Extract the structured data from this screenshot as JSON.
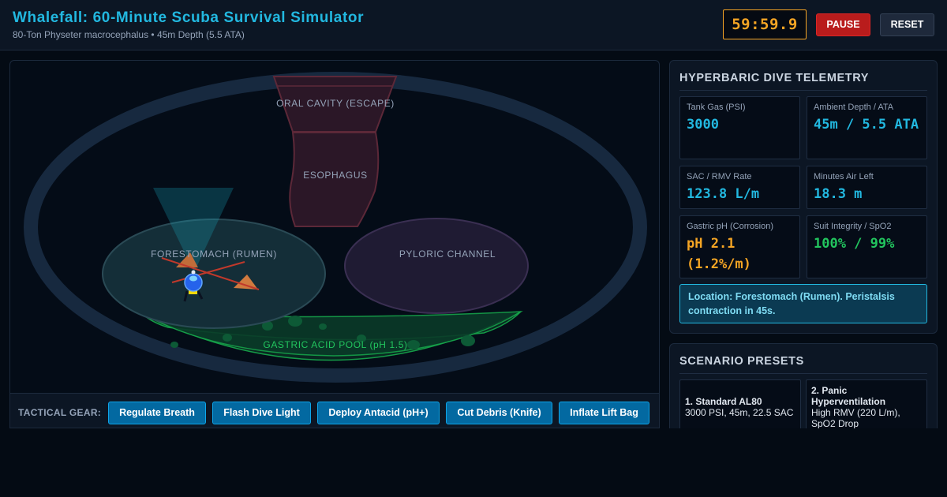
{
  "header": {
    "title": "Whalefall: 60-Minute Scuba Survival Simulator",
    "subtitle": "80-Ton Physeter macrocephalus • 45m Depth (5.5 ATA)",
    "timer": "59:59.9",
    "pause_label": "PAUSE",
    "reset_label": "RESET"
  },
  "map": {
    "regions": {
      "oral": "ORAL CAVITY (ESCAPE)",
      "esophagus": "ESOPHAGUS",
      "forestomach": "FORESTOMACH (RUMEN)",
      "pyloric": "PYLORIC CHANNEL",
      "acid_pool": "GASTRIC ACID POOL (pH 1.5)"
    }
  },
  "gear": {
    "label": "TACTICAL GEAR:",
    "buttons": [
      "Regulate Breath",
      "Flash Dive Light",
      "Deploy Antacid (pH+)",
      "Cut Debris (Knife)",
      "Inflate Lift Bag"
    ]
  },
  "telemetry": {
    "title": "HYPERBARIC DIVE TELEMETRY",
    "stats": [
      {
        "label": "Tank Gas (PSI)",
        "value": "3000"
      },
      {
        "label": "Ambient Depth / ATA",
        "value": "45m / 5.5 ATA"
      },
      {
        "label": "SAC / RMV Rate",
        "value": "123.8 L/m"
      },
      {
        "label": "Minutes Air Left",
        "value": "18.3 m"
      },
      {
        "label": "Gastric pH (Corrosion)",
        "value": "pH 2.1 (1.2%/m)"
      },
      {
        "label": "Suit Integrity / SpO2",
        "value": "100% / 99%"
      }
    ],
    "status": "Location: Forestomach (Rumen). Peristalsis contraction in 45s."
  },
  "presets": {
    "title": "SCENARIO PRESETS",
    "items": [
      {
        "name": "1. Standard AL80",
        "desc": "3000 PSI, 45m, 22.5 SAC"
      },
      {
        "name": "2. Panic Hyperventilation",
        "desc": "High RMV (220 L/m), SpO2 Drop"
      }
    ]
  },
  "colors": {
    "accent": "#22b8e0",
    "timer": "#f5a524",
    "danger": "#b91c1c",
    "gear_button": "#0369a1",
    "value_blue": "#22b8e0",
    "value_orange": "#f5a524",
    "value_green": "#22c55e"
  },
  "icons": {
    "diver": "diver-icon",
    "debris": "debris-icon",
    "dive_light": "dive-light-beam"
  }
}
